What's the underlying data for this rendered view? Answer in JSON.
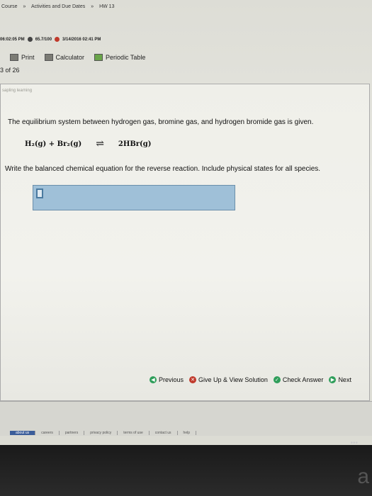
{
  "breadcrumb": {
    "items": [
      "Course",
      "Activities and Due Dates",
      "HW 13"
    ]
  },
  "status": {
    "start": "06:02:05 PM",
    "score": "65.7/100",
    "end": "3/14/2016 02:41 PM"
  },
  "toolbar": {
    "print": "Print",
    "calculator": "Calculator",
    "periodic": "Periodic Table"
  },
  "question": {
    "counter": "3 of 26",
    "brand": "sapling learning",
    "prompt": "The equilibrium system between hydrogen gas, bromine gas, and hydrogen bromide gas is given.",
    "lhs": "H₂(g) + Br₂(g)",
    "arrows": "⇌",
    "rhs": "2HBr(g)",
    "instruction": "Write the balanced chemical equation for the reverse reaction. Include physical states for all species."
  },
  "nav": {
    "previous": "Previous",
    "give_up": "Give Up & View Solution",
    "check": "Check Answer",
    "next": "Next"
  },
  "footer": {
    "links": [
      "about us",
      "careers",
      "partners",
      "privacy policy",
      "terms of use",
      "contact us",
      "help"
    ]
  },
  "device": {
    "dots": "•••",
    "logo": "a"
  }
}
